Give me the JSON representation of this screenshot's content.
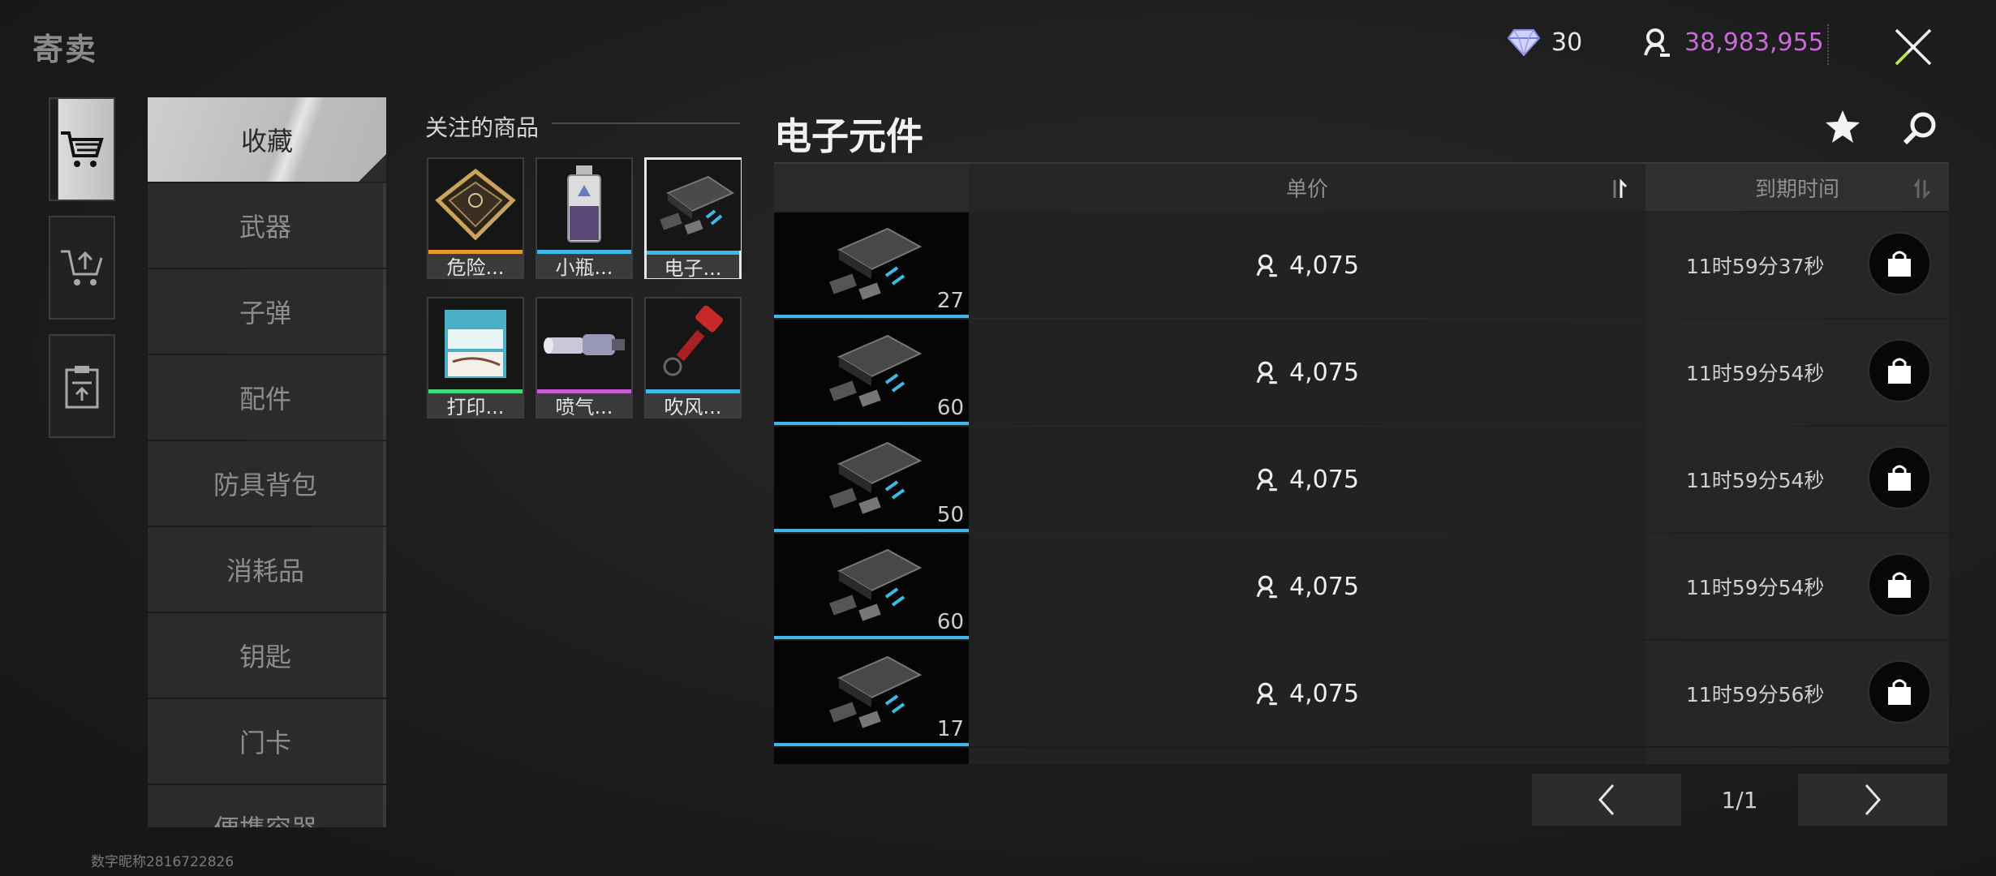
{
  "window": {
    "title": "寄卖"
  },
  "header": {
    "gem": {
      "icon": "diamond-icon",
      "value": "30"
    },
    "coin": {
      "icon": "coin-icon",
      "value": "38,983,955",
      "color": "#c86ad8"
    },
    "close_icon": "close-icon"
  },
  "rail": [
    {
      "icon": "cart-icon",
      "active": true
    },
    {
      "icon": "cart-upload-icon",
      "active": false
    },
    {
      "icon": "clipboard-upload-icon",
      "active": false
    }
  ],
  "categories": [
    "收藏",
    "武器",
    "子弹",
    "配件",
    "防具背包",
    "消耗品",
    "钥匙",
    "门卡",
    "便携容器"
  ],
  "favorites": {
    "title": "关注的商品",
    "items": [
      {
        "label": "危险...",
        "bar_color": "#e39a2a"
      },
      {
        "label": "小瓶...",
        "bar_color": "#3fb8e6"
      },
      {
        "label": "电子...",
        "bar_color": "#3fb8e6",
        "selected": true
      },
      {
        "label": "打印...",
        "bar_color": "#45d87a"
      },
      {
        "label": "喷气...",
        "bar_color": "#c85ad8"
      },
      {
        "label": "吹风...",
        "bar_color": "#3fb8e6"
      }
    ]
  },
  "main": {
    "title": "电子元件",
    "columns": {
      "price": "单价",
      "expire": "到期时间"
    },
    "rows": [
      {
        "qty": "27",
        "price": "4,075",
        "expire": "11时59分37秒"
      },
      {
        "qty": "60",
        "price": "4,075",
        "expire": "11时59分54秒"
      },
      {
        "qty": "50",
        "price": "4,075",
        "expire": "11时59分54秒"
      },
      {
        "qty": "60",
        "price": "4,075",
        "expire": "11时59分54秒"
      },
      {
        "qty": "17",
        "price": "4,075",
        "expire": "11时59分56秒"
      }
    ],
    "pagination": "1/1"
  },
  "footer": "数字昵称2816722826"
}
